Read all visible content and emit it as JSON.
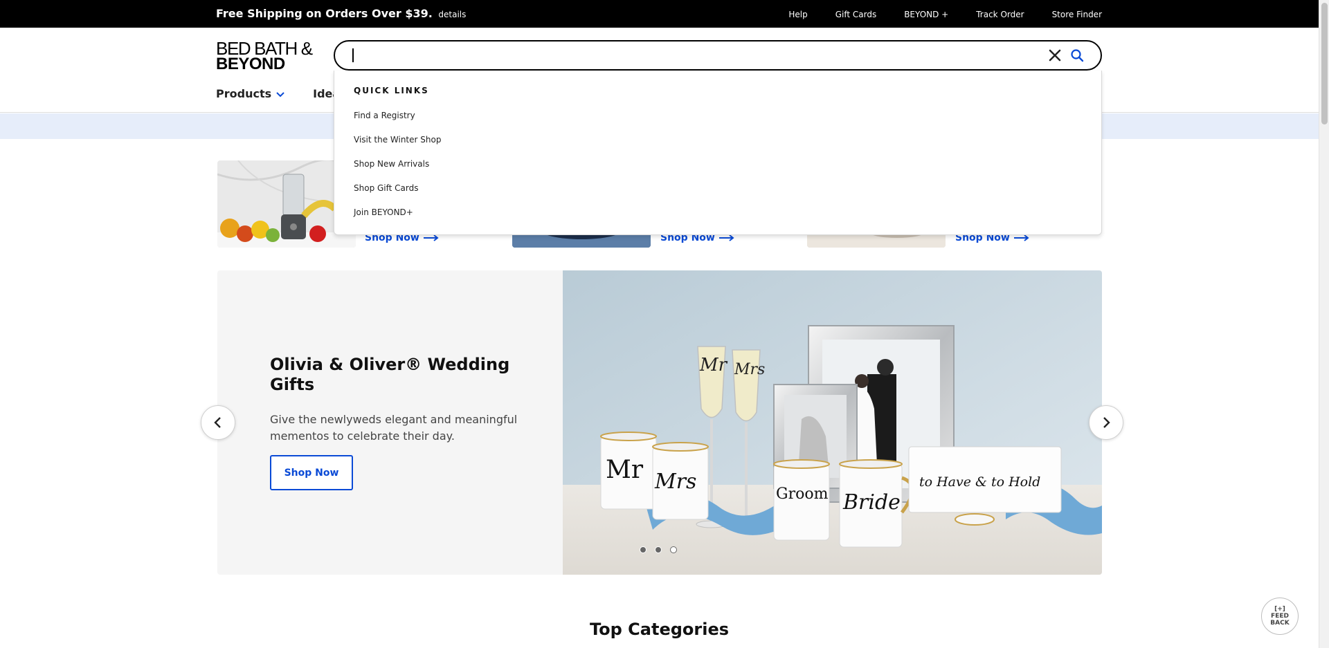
{
  "promo_bar": {
    "message": "Free Shipping on Orders Over $39.",
    "details_link": "details",
    "links": [
      "Help",
      "Gift Cards",
      "BEYOND +",
      "Track Order",
      "Store Finder"
    ]
  },
  "header": {
    "logo": {
      "line1": "BED BATH &",
      "line2": "BEYOND"
    },
    "nav": [
      {
        "label": "Products"
      },
      {
        "label": "Idea"
      }
    ]
  },
  "search": {
    "value": "",
    "placeholder": "",
    "quick_links_title": "QUICK LINKS",
    "quick_links": [
      "Find a Registry",
      "Visit the Winter Shop",
      "Shop New Arrivals",
      "Shop Gift Cards",
      "Join BEYOND+"
    ]
  },
  "promo_tiles": [
    {
      "link": "Shop Now"
    },
    {
      "link": "Shop Now"
    },
    {
      "link": "Shop Now"
    }
  ],
  "hero": {
    "title": "Olivia & Oliver® Wedding Gifts",
    "description": "Give the newlyweds elegant and meaningful mementos to celebrate their day.",
    "cta": "Shop Now",
    "mug_text": [
      "Mr",
      "Mrs",
      "Groom",
      "Bride"
    ],
    "glass_text": [
      "Mr",
      "Mrs"
    ],
    "tray_text": "to Have & to Hold",
    "active_slide": 3,
    "slide_count": 3
  },
  "top_categories": {
    "title": "Top Categories"
  },
  "feedback": {
    "line1": "[+]",
    "line2": "FEED",
    "line3": "BACK"
  },
  "colors": {
    "accent_blue": "#0a4ad6",
    "banner_strip": "#e6edfa",
    "black": "#000000"
  }
}
